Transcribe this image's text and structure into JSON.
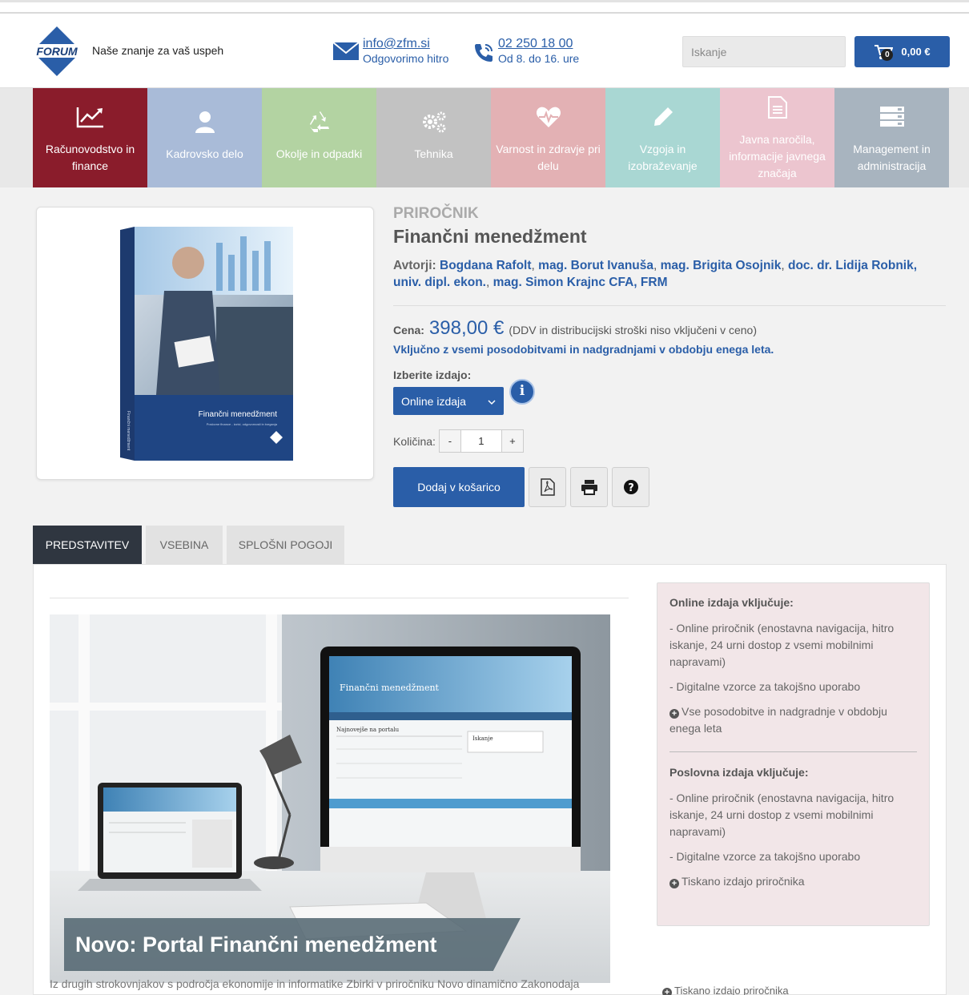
{
  "header": {
    "logo_text": "FORUM",
    "tagline": "Naše znanje za vaš uspeh",
    "email": "info@zfm.si",
    "email_sub": "Odgovorimo hitro",
    "phone": "02 250 18 00",
    "phone_sub": "Od 8. do 16. ure",
    "search_placeholder": "Iskanje",
    "cart_count": "0",
    "cart_total": "0,00 €"
  },
  "nav": [
    {
      "label": "Računovodstvo in finance",
      "icon": "chart-icon",
      "color": "#8a1c2b"
    },
    {
      "label": "Kadrovsko delo",
      "icon": "user-icon",
      "color": "#a9bbd8"
    },
    {
      "label": "Okolje in odpadki",
      "icon": "recycle-icon",
      "color": "#b3d3a2"
    },
    {
      "label": "Tehnika",
      "icon": "gears-icon",
      "color": "#c2c2c2"
    },
    {
      "label": "Varnost in zdravje pri delu",
      "icon": "heartbeat-icon",
      "color": "#e3b1b4"
    },
    {
      "label": "Vzgoja in izobraževanje",
      "icon": "pencil-icon",
      "color": "#a9d7d3"
    },
    {
      "label": "Javna naročila, informacije javnega značaja",
      "icon": "document-icon",
      "color": "#ecc5cf"
    },
    {
      "label": "Management in administracija",
      "icon": "server-icon",
      "color": "#a8b4bf"
    }
  ],
  "product": {
    "category": "PRIROČNIK",
    "title": "Finančni menedžment",
    "authors_label": "Avtorji:",
    "authors": [
      "Bogdana Rafolt",
      "mag. Borut Ivanuša",
      "mag. Brigita Osojnik",
      "doc. dr. Lidija Robnik, univ. dipl. ekon.",
      "mag. Simon Krajnc CFA, FRM"
    ],
    "price_label": "Cena:",
    "price": "398,00 €",
    "price_note": "(DDV in distribucijski stroški niso vključeni v ceno)",
    "included": "Vključno z vsemi posodobitvami in nadgradnjami v obdobju enega leta.",
    "edition_label": "Izberite izdajo:",
    "edition_value": "Online izdaja",
    "qty_label": "Količina:",
    "qty_value": "1",
    "add_to_cart": "Dodaj v košarico",
    "book_cover_title": "Finančni menedžment",
    "book_cover_sub": "Poslovne finance - izzivi, odgovornosti in tveganja"
  },
  "tabs": [
    "PREDSTAVITEV",
    "VSEBINA",
    "SPLOŠNI POGOJI"
  ],
  "hero": {
    "caption": "Novo: Portal Finančni menedžment",
    "screen_title": "Finančni menedžment",
    "screen_side": "Iskanje",
    "screen_news": "Najnovejše na portalu"
  },
  "under_text": "Iz drugih strokovnjakov s področja ekonomije in informatike Zbirki v priročniku Novo dinamično Zakonodaja",
  "sidebar": {
    "online_title": "Online izdaja vključuje:",
    "online_items": [
      "- Online priročnik (enostavna navigacija, hitro iskanje, 24 urni dostop z vsemi mobilnimi napravami)",
      "- Digitalne vzorce za takojšno uporabo",
      "Vse posodobitve in nadgradnje v obdobju enega leta"
    ],
    "business_title": "Poslovna izdaja vključuje:",
    "business_items": [
      "- Online priročnik (enostavna navigacija, hitro iskanje, 24 urni dostop z vsemi mobilnimi napravami)",
      "- Digitalne vzorce za takojšno uporabo",
      "Tiskano izdajo priročnika"
    ],
    "ghost": "Tiskano izdajo priročnika"
  }
}
